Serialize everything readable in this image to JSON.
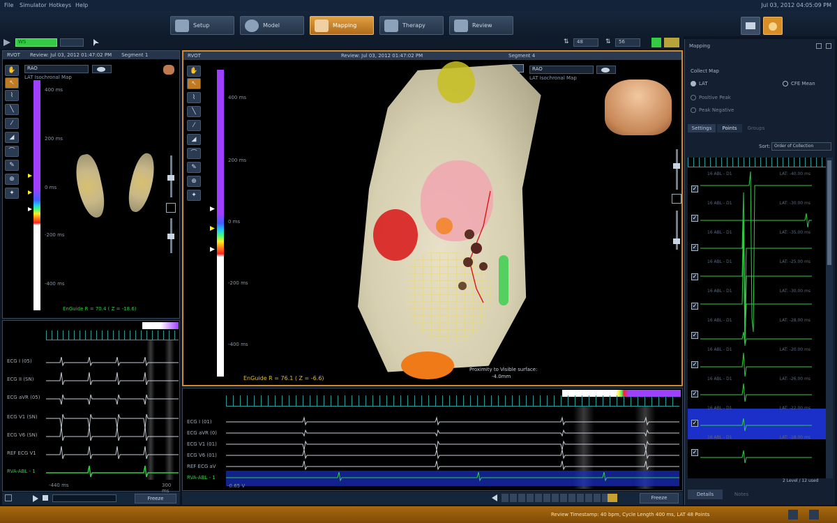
{
  "menu": {
    "items": [
      "File",
      "Simulator",
      "Hotkeys",
      "Help"
    ],
    "clock": "Jul 03, 2012 04:05:09 PM"
  },
  "tabs": [
    {
      "label": "Setup",
      "active": false
    },
    {
      "label": "Model",
      "active": false
    },
    {
      "label": "Mapping",
      "active": true
    },
    {
      "label": "Therapy",
      "active": false
    },
    {
      "label": "Review",
      "active": false
    }
  ],
  "colors": {
    "accent": "#e0a040",
    "lat_purple": "#a040ff",
    "ecg_green": "#33cc44",
    "highlight_blue": "#1a30c8"
  },
  "toolbar": {
    "dropdown_value": "WS",
    "counter_a": "48",
    "counter_b": "56"
  },
  "left_panel": {
    "header": [
      "RVOT",
      "Review: Jul 03, 2012 01:47:02 PM",
      "Segment 1"
    ],
    "view_select": "RAO",
    "map_name": "LAT Isochronal Map",
    "scale_ticks": [
      "400 ms",
      "200 ms",
      "0 ms",
      "-200 ms",
      "-400 ms"
    ],
    "ensuite": "EnGuide R = 70.4  ( Z = -18.6)"
  },
  "center_panel": {
    "header": [
      "RVOT",
      "Review: Jul 03, 2012 01:47:02 PM",
      "Segment 4"
    ],
    "view_select": "RAO",
    "map_name": "LAT Isochronal Map",
    "scale_ticks": [
      "400 ms",
      "200 ms",
      "0 ms",
      "-200 ms",
      "-400 ms"
    ],
    "proximity": "Proximity to Visible surface:",
    "proximity_val": "-4.0mm",
    "ensuite": "EnGuide R = 76.1  ( Z = -6.6)"
  },
  "ecg_left": {
    "channels": [
      "ECG I (05)",
      "ECG II (SN)",
      "ECG aVR (05)",
      "ECG V1 (SN)",
      "ECG V6 (SN)",
      "REF ECG V1",
      "RVA-ABL - 1"
    ],
    "footer_left": "-440 ms",
    "footer_right": "300 ms",
    "freeze_label": "Freeze"
  },
  "ecg_center": {
    "channels": [
      "ECG I (01)",
      "ECG aVR (0)",
      "ECG V1 (01)",
      "ECG V6 (01)",
      "REF ECG aV",
      "RVA-ABL - 1"
    ],
    "footer_left": "-0.65 V",
    "freeze_label": "Freeze"
  },
  "right_panel": {
    "title": "Mapping",
    "subtitle": "Collect Map",
    "options": [
      "LAT",
      "CFE Mean",
      "Positive Peak",
      "Peak Negative"
    ],
    "tabs": [
      "Settings",
      "Points",
      "Groups"
    ],
    "sort_label": "Sort:",
    "sort_value": "Order of Collection",
    "points": [
      {
        "label": "16 ABL - D1",
        "value": "LAT: -40.00 ms"
      },
      {
        "label": "16 ABL - D1",
        "value": "LAT: -30.00 ms"
      },
      {
        "label": "16 ABL - D1",
        "value": "LAT: -35.00 ms"
      },
      {
        "label": "16 ABL - D1",
        "value": "LAT: -25.00 ms"
      },
      {
        "label": "16 ABL - D1",
        "value": "LAT: -30.00 ms"
      },
      {
        "label": "16 ABL - D1",
        "value": "LAT: -28.00 ms"
      },
      {
        "label": "16 ABL - D1",
        "value": "LAT: -20.00 ms"
      },
      {
        "label": "16 ABL - D1",
        "value": "LAT: -26.00 ms"
      },
      {
        "label": "16 ABL - D1",
        "value": "LAT: -22.00 ms"
      },
      {
        "label": "16 ABL - D1",
        "value": "LAT: -18.00 ms"
      }
    ],
    "footer": "2 Level / 12 used",
    "bottom_tabs": [
      "Details",
      "Notes"
    ]
  },
  "status": {
    "text": "Review Timestamp: 40 bpm, Cycle Length 400 ms, LAT 48 Points"
  }
}
